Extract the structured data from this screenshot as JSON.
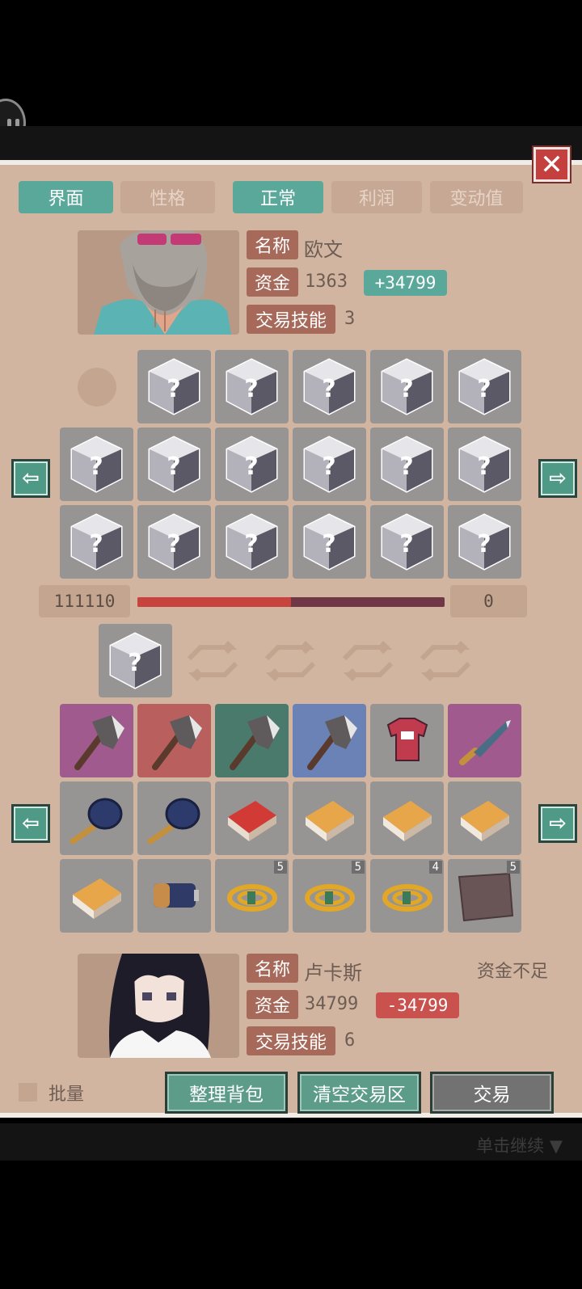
{
  "tabs": [
    {
      "label": "界面",
      "active": true
    },
    {
      "label": "性格",
      "active": false
    },
    {
      "label": "正常",
      "active": true
    },
    {
      "label": "利润",
      "active": false
    },
    {
      "label": "变动值",
      "active": false
    }
  ],
  "top_trader": {
    "name_label": "名称",
    "name": "欧文",
    "funds_label": "资金",
    "funds": "1363",
    "funds_delta": "+34799",
    "skill_label": "交易技能",
    "skill": "3"
  },
  "bottom_trader": {
    "name_label": "名称",
    "name": "卢卡斯",
    "funds_label": "资金",
    "funds": "34799",
    "funds_delta": "-34799",
    "skill_label": "交易技能",
    "skill": "6",
    "status": "资金不足"
  },
  "progress": {
    "left_value": "111110",
    "right_value": "0",
    "fill_fraction": 0.5
  },
  "bottom_inventory": [
    {
      "item": "axe",
      "bg": "#a15a8e"
    },
    {
      "item": "axe",
      "bg": "#b9605f"
    },
    {
      "item": "axe",
      "bg": "#4a7a6c"
    },
    {
      "item": "axe",
      "bg": "#6a82b6"
    },
    {
      "item": "red-shirt",
      "bg": "#979593"
    },
    {
      "item": "knife",
      "bg": "#a15a8e"
    },
    {
      "item": "frying-pan",
      "bg": "#979593"
    },
    {
      "item": "frying-pan",
      "bg": "#979593"
    },
    {
      "item": "red-cigarette-pack",
      "bg": "#979593"
    },
    {
      "item": "cigarette-pack",
      "bg": "#979593"
    },
    {
      "item": "cigarette-pack",
      "bg": "#979593"
    },
    {
      "item": "cigarette-pack",
      "bg": "#979593"
    },
    {
      "item": "cigarette-pack",
      "bg": "#979593"
    },
    {
      "item": "battery",
      "bg": "#979593"
    },
    {
      "item": "rope",
      "bg": "#979593",
      "count": "5"
    },
    {
      "item": "rope",
      "bg": "#979593",
      "count": "5"
    },
    {
      "item": "rope",
      "bg": "#979593",
      "count": "4"
    },
    {
      "item": "cloth",
      "bg": "#979593",
      "count": "5"
    }
  ],
  "batch_label": "批量",
  "buttons": {
    "sort": "整理背包",
    "clear": "清空交易区",
    "trade": "交易"
  },
  "continue_label": "单击继续"
}
